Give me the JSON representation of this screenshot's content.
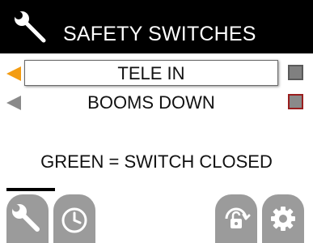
{
  "header": {
    "icon": "wrench-icon",
    "title": "SAFETY SWITCHES"
  },
  "switches": [
    {
      "label": "TELE IN",
      "selected": true,
      "status": "grey"
    },
    {
      "label": "BOOMS DOWN",
      "selected": false,
      "status": "grey"
    }
  ],
  "legend": "GREEN = SWITCH CLOSED",
  "bottom_bar": {
    "buttons": [
      {
        "icon": "wrench-icon",
        "active": true
      },
      {
        "icon": "clock-icon",
        "active": false
      },
      {
        "icon": "unlock-icon",
        "active": false
      },
      {
        "icon": "gear-icon",
        "active": false
      }
    ]
  },
  "colors": {
    "title_bar": "#000000",
    "selection_arrow": "#f39c12",
    "inactive_arrow": "#8a8a8a",
    "button_grey": "#9b9b9b",
    "status_grey": "#808080"
  }
}
